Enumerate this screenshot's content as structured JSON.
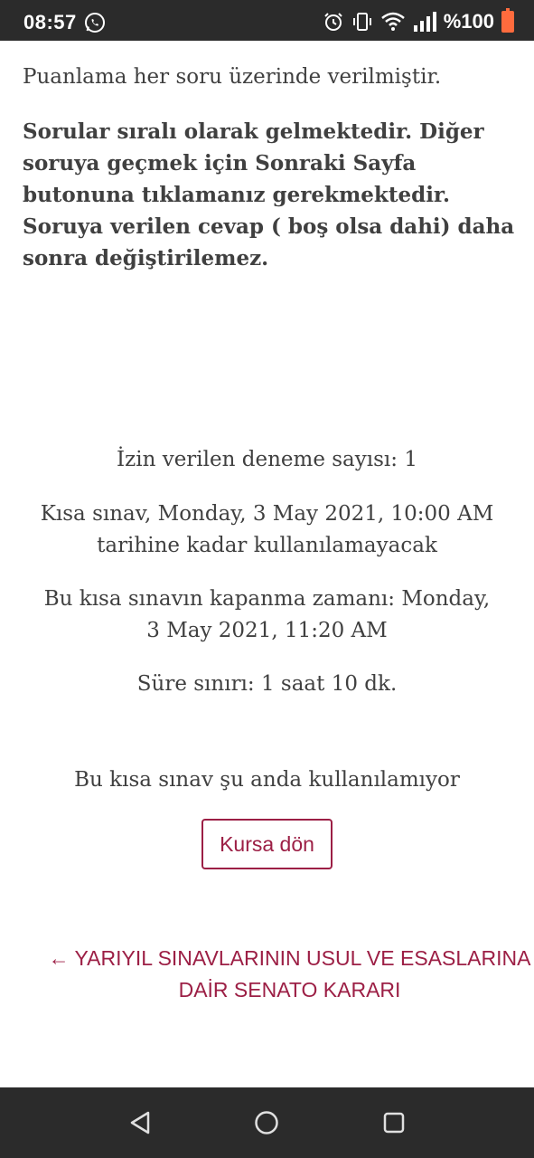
{
  "status_bar": {
    "time": "08:57",
    "battery": "%100",
    "icons": [
      "whatsapp-icon",
      "alarm-icon",
      "vibrate-icon",
      "wifi-icon",
      "signal-icon",
      "battery-icon"
    ],
    "battery_color": "#ff6b3d"
  },
  "quiz": {
    "intro": "Puanlama her soru üzerinde verilmiştir.",
    "rules": "Sorular sıralı olarak gelmektedir. Diğer soruya geçmek için Sonraki Sayfa butonuna tıklamanız gerekmektedir. Soruya verilen cevap ( boş olsa dahi) daha sonra değiştirilemez.",
    "attempts_allowed": "İzin verilen deneme sayısı: 1",
    "open_time": "Kısa sınav, Monday, 3 May 2021, 10:00 AM tarihine kadar kullanılamayacak",
    "close_time": "Bu kısa sınavın kapanma zamanı: Monday, 3 May 2021, 11:20 AM",
    "time_limit": "Süre sınırı: 1 saat 10 dk.",
    "unavailable": "Bu kısa sınav şu anda kullanılamıyor",
    "back_button": "Kursa dön",
    "prev_link": "← YARIYIL SINAVLARININ USUL VE ESASLARINA DAİR SENATO KARARI"
  },
  "colors": {
    "accent": "#9c1f45",
    "text": "#404040",
    "system_bar": "#2b2b2b"
  },
  "nav_bar": {
    "icons": [
      "back-triangle-icon",
      "home-circle-icon",
      "recents-square-icon"
    ]
  }
}
